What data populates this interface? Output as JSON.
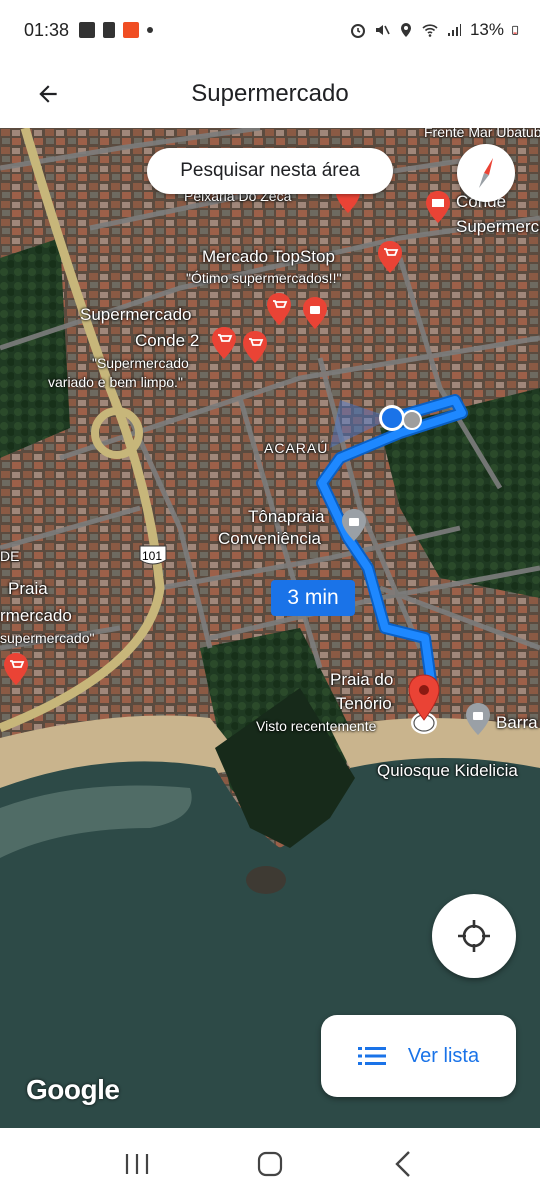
{
  "status_bar": {
    "time": "01:38",
    "battery": "13%"
  },
  "app_bar": {
    "title": "Supermercado",
    "back_icon": "arrow-left-icon"
  },
  "map": {
    "search_area_label": "Pesquisar nesta área",
    "eta_label": "3 min",
    "highway_shield": "101",
    "labels": {
      "frente_mar": "Frente Mar Ubatuba",
      "peixaria": "Peixaria Do Zeca",
      "conde_top": "Conde",
      "conde_top_2": "Supermercado",
      "topstop_name": "Mercado TopStop",
      "topstop_review": "\"Ótimo supermercados!!\"",
      "conde2_line1": "Supermercado",
      "conde2_line2": "Conde 2",
      "conde2_review_1": "\"Supermercado",
      "conde2_review_2": "variado e bem limpo.\"",
      "acarau": "ACARAÚ",
      "tonapraia_1": "Tônapraia",
      "tonapraia_2": "Conveniência",
      "left_de": "DE",
      "left_praia": "Praia",
      "left_mercado": "rmercado",
      "left_review": "supermercado\"",
      "tenorio_1": "Praia do",
      "tenorio_2": "Tenório",
      "tenorio_3": "Visto recentemente",
      "barra": "Barra",
      "quiosque": "Quiosque Kidelicia"
    }
  },
  "buttons": {
    "my_location": "crosshair-icon",
    "list_label": "Ver lista"
  },
  "branding": {
    "google": "Google"
  },
  "colors": {
    "route": "#1e88ff",
    "pin_red": "#ea4335",
    "accent": "#1a73e8"
  }
}
